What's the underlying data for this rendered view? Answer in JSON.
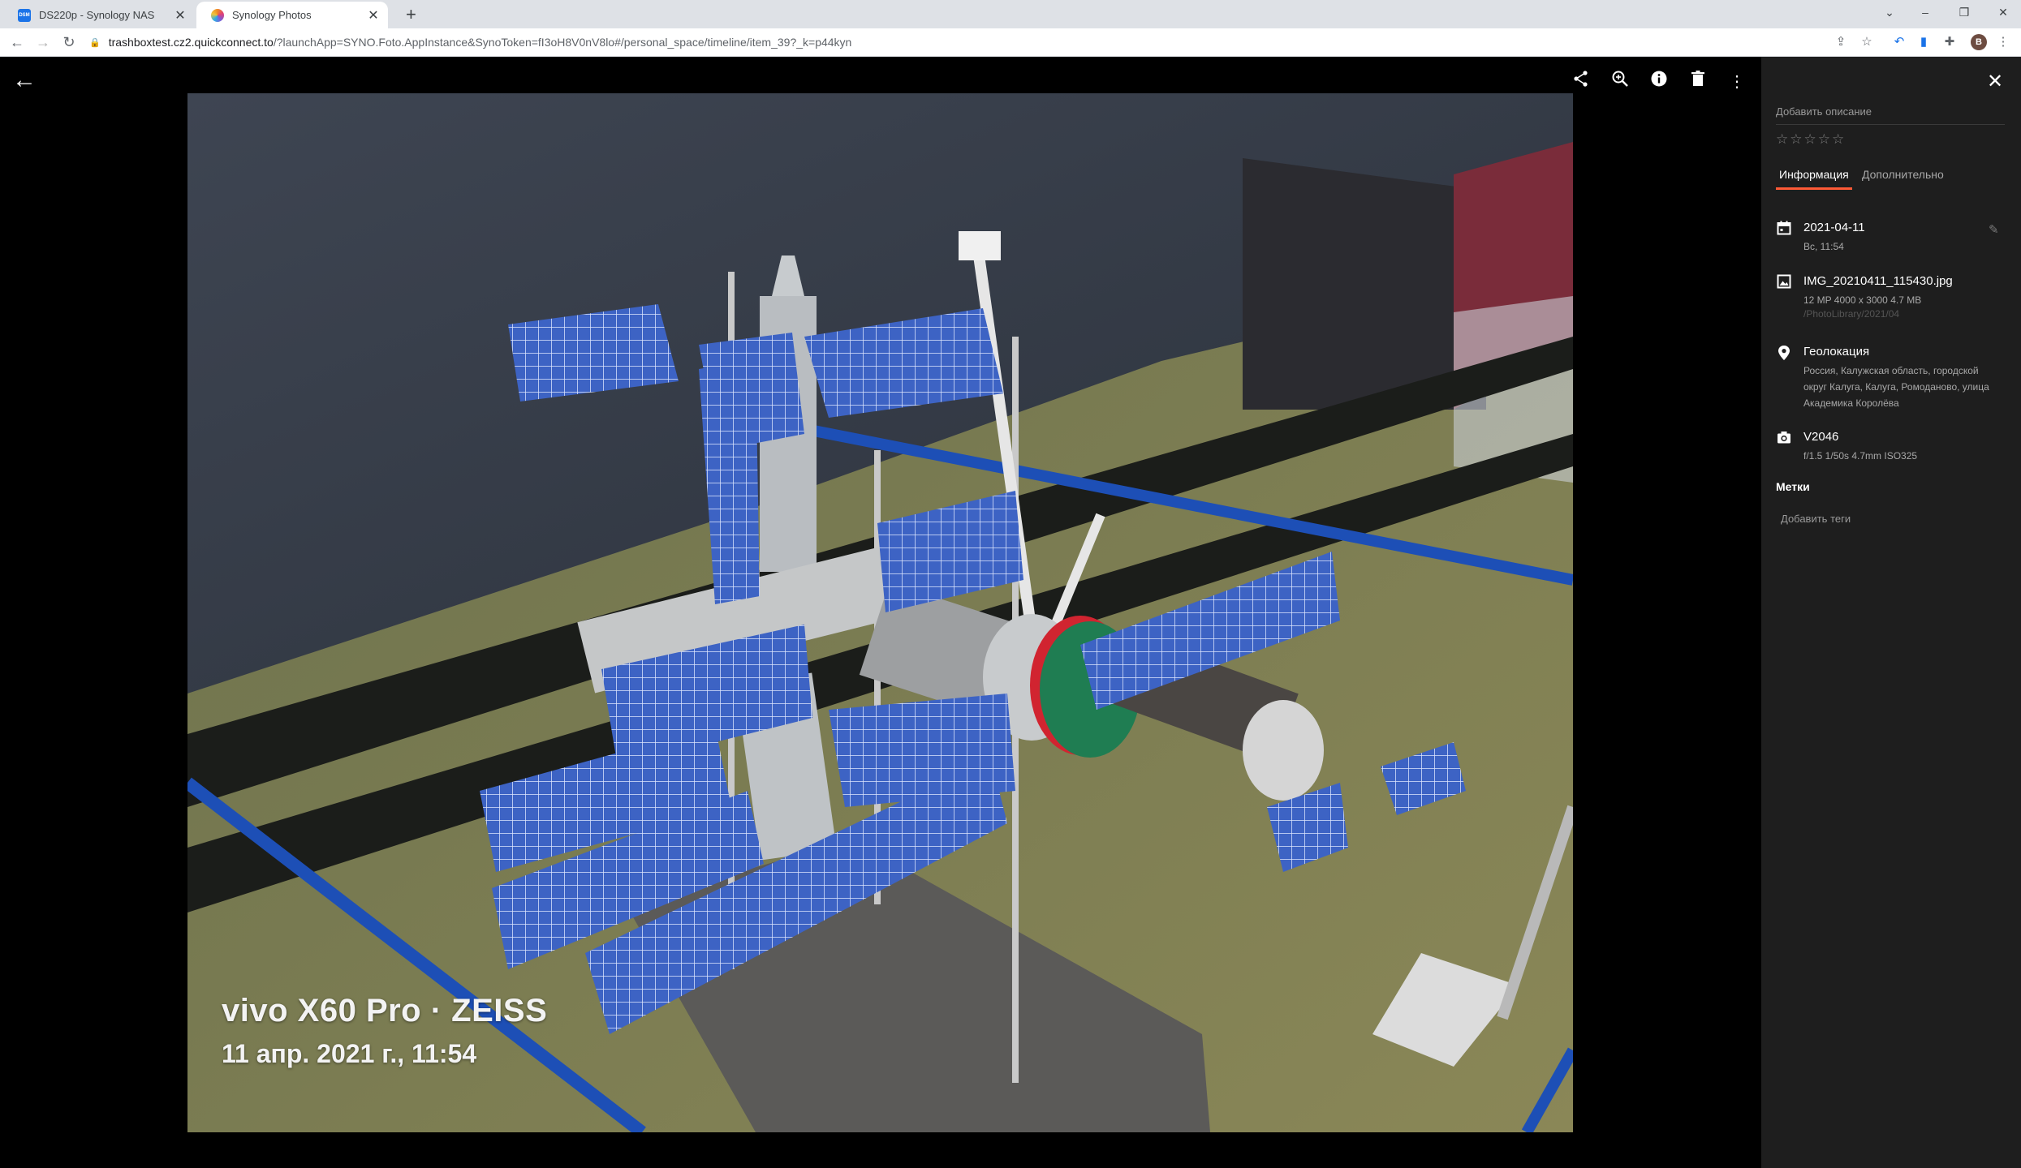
{
  "browser": {
    "tabs": [
      {
        "label": "DS220p - Synology NAS",
        "active": false,
        "favicon": "dsm-icon",
        "favicon_color": "#1a73e8",
        "favicon_text": "DSM"
      },
      {
        "label": "Synology Photos",
        "active": true,
        "favicon": "synology-photos-icon",
        "favicon_color": "#f08a24"
      }
    ],
    "new_tab": "+",
    "url_host": "trashboxtest.cz2.quickconnect.to",
    "url_rest": "/?launchApp=SYNO.Foto.AppInstance&SynoToken=fI3oH8V0nV8lo#/personal_space/timeline/item_39?_k=p44kyn",
    "profile_initial": "B"
  },
  "viewer": {
    "watermark_model": "vivo X60 Pro · ZEISS",
    "watermark_date": "11 апр. 2021 г., 11:54"
  },
  "panel": {
    "description_placeholder": "Добавить описание",
    "rating_stars": 5,
    "rating_value": 0,
    "tabs": {
      "info": "Информация",
      "more": "Дополнительно"
    },
    "date": {
      "value": "2021-04-11",
      "sub": "Вс, 11:54"
    },
    "file": {
      "name": "IMG_20210411_115430.jpg",
      "sub": "12 MP   4000 x 3000   4.7 MB",
      "path": "/PhotoLibrary/2021/04"
    },
    "location": {
      "title": "Геолокация",
      "address": "Россия, Калужская область, городской округ Калуга, Калуга, Ромоданово, улица Академика Королёва"
    },
    "camera": {
      "model": "V2046",
      "exif": "f/1.5   1/50s   4.7mm   ISO325"
    },
    "tags_heading": "Метки",
    "add_tags": "Добавить теги",
    "accent": "#ff5a36"
  }
}
